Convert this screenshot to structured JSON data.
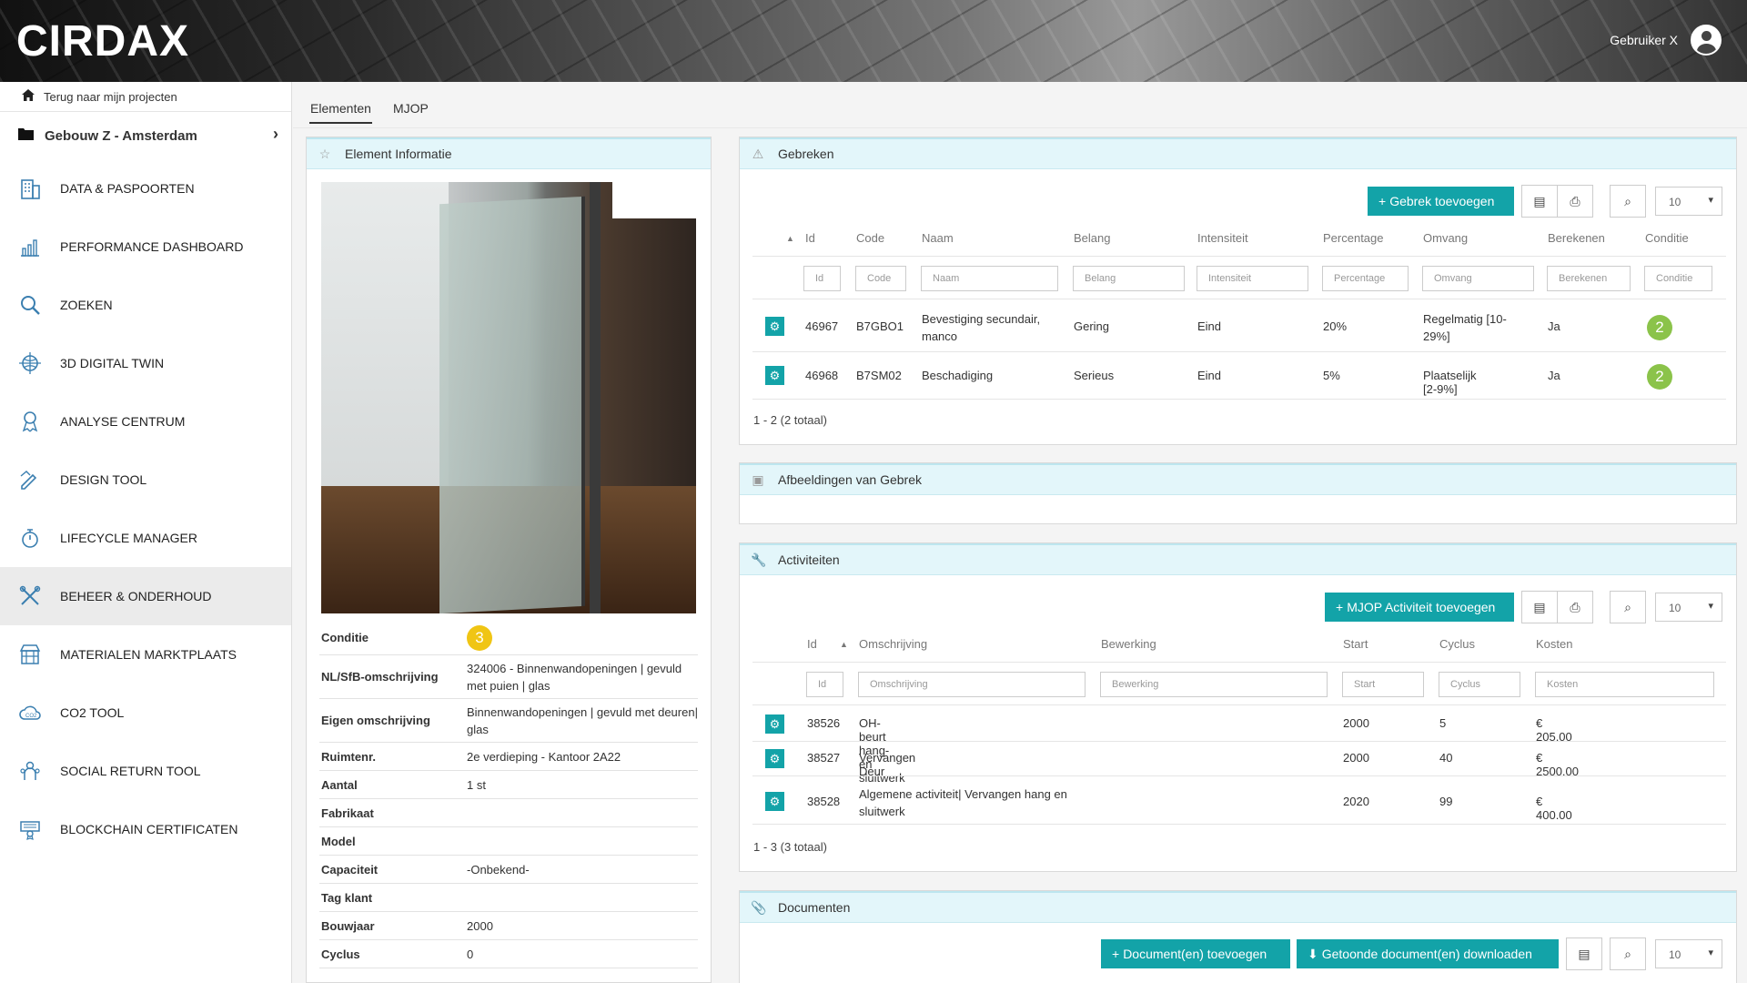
{
  "header": {
    "logo": "CIRDAX",
    "user": "Gebruiker X"
  },
  "sidebar": {
    "back_label": "Terug naar mijn projecten",
    "project": "Gebouw Z - Amsterdam",
    "items": [
      {
        "label": "DATA & PASPOORTEN"
      },
      {
        "label": "PERFORMANCE DASHBOARD"
      },
      {
        "label": "ZOEKEN"
      },
      {
        "label": "3D DIGITAL TWIN"
      },
      {
        "label": "ANALYSE CENTRUM"
      },
      {
        "label": "DESIGN TOOL"
      },
      {
        "label": "LIFECYCLE MANAGER"
      },
      {
        "label": "BEHEER & ONDERHOUD"
      },
      {
        "label": "MATERIALEN MARKTPLAATS"
      },
      {
        "label": "CO2 TOOL"
      },
      {
        "label": "SOCIAL RETURN TOOL"
      },
      {
        "label": "BLOCKCHAIN CERTIFICATEN"
      }
    ]
  },
  "tabs": [
    {
      "label": "Elementen"
    },
    {
      "label": "MJOP"
    }
  ],
  "element": {
    "title": "Element Informatie",
    "rows": [
      {
        "key": "Conditie",
        "value": "3"
      },
      {
        "key": "NL/SfB-omschrijving",
        "value": "324006 - Binnenwandopeningen | gevuld met puien | glas"
      },
      {
        "key": "Eigen omschrijving",
        "value": "Binnenwandopeningen | gevuld met deuren| glas"
      },
      {
        "key": "Ruimtenr.",
        "value": "2e verdieping - Kantoor 2A22"
      },
      {
        "key": "Aantal",
        "value": "1 st"
      },
      {
        "key": "Fabrikaat",
        "value": ""
      },
      {
        "key": "Model",
        "value": ""
      },
      {
        "key": "Capaciteit",
        "value": "-Onbekend-"
      },
      {
        "key": "Tag klant",
        "value": ""
      },
      {
        "key": "Bouwjaar",
        "value": "2000"
      },
      {
        "key": "Cyclus",
        "value": "0"
      }
    ]
  },
  "gebreken": {
    "title": "Gebreken",
    "add_label": "Gebrek toevoegen",
    "page_size": "10",
    "headers": [
      "Id",
      "Code",
      "Naam",
      "Belang",
      "Intensiteit",
      "Percentage",
      "Omvang",
      "Berekenen",
      "Conditie"
    ],
    "filters": [
      "Id",
      "Code",
      "Naam",
      "Belang",
      "Intensiteit",
      "Percentage",
      "Omvang",
      "Berekenen",
      "Conditie"
    ],
    "rows": [
      {
        "id": "46967",
        "code": "B7GBO1",
        "naam": "Bevestiging secundair, manco",
        "belang": "Gering",
        "intensiteit": "Eind",
        "percentage": "20%",
        "omvang": "Regelmatig [10-29%]",
        "berekenen": "Ja",
        "conditie": "2"
      },
      {
        "id": "46968",
        "code": "B7SM02",
        "naam": "Beschadiging",
        "belang": "Serieus",
        "intensiteit": "Eind",
        "percentage": "5%",
        "omvang": "Plaatselijk [2-9%]",
        "berekenen": "Ja",
        "conditie": "2"
      }
    ],
    "footer": "1 - 2 (2 totaal)"
  },
  "afbeeldingen": {
    "title": "Afbeeldingen van Gebrek"
  },
  "activiteiten": {
    "title": "Activiteiten",
    "add_label": "MJOP Activiteit toevoegen",
    "page_size": "10",
    "headers": [
      "Id",
      "Omschrijving",
      "Bewerking",
      "Start",
      "Cyclus",
      "Kosten"
    ],
    "filters": [
      "Id",
      "Omschrijving",
      "Bewerking",
      "Start",
      "Cyclus",
      "Kosten"
    ],
    "rows": [
      {
        "id": "38526",
        "omschrijving": "OH-beurt hang- en sluitwerk",
        "start": "2000",
        "cyclus": "5",
        "kosten": "€ 205.00"
      },
      {
        "id": "38527",
        "omschrijving": "Vervangen Deur",
        "start": "2000",
        "cyclus": "40",
        "kosten": "€ 2500.00"
      },
      {
        "id": "38528",
        "omschrijving": "Algemene activiteit| Vervangen hang en sluitwerk",
        "start": "2020",
        "cyclus": "99",
        "kosten": "€ 400.00"
      }
    ],
    "footer": "1 - 3 (3 totaal)"
  },
  "documenten": {
    "title": "Documenten",
    "add_label": "Document(en) toevoegen",
    "download_label": "Getoonde document(en) downloaden",
    "page_size": "10"
  },
  "colors": {
    "accent": "#13a3a8",
    "header_panel": "#e3f6fa",
    "badge_yellow": "#f0c514",
    "badge_green": "#8bc34a"
  }
}
